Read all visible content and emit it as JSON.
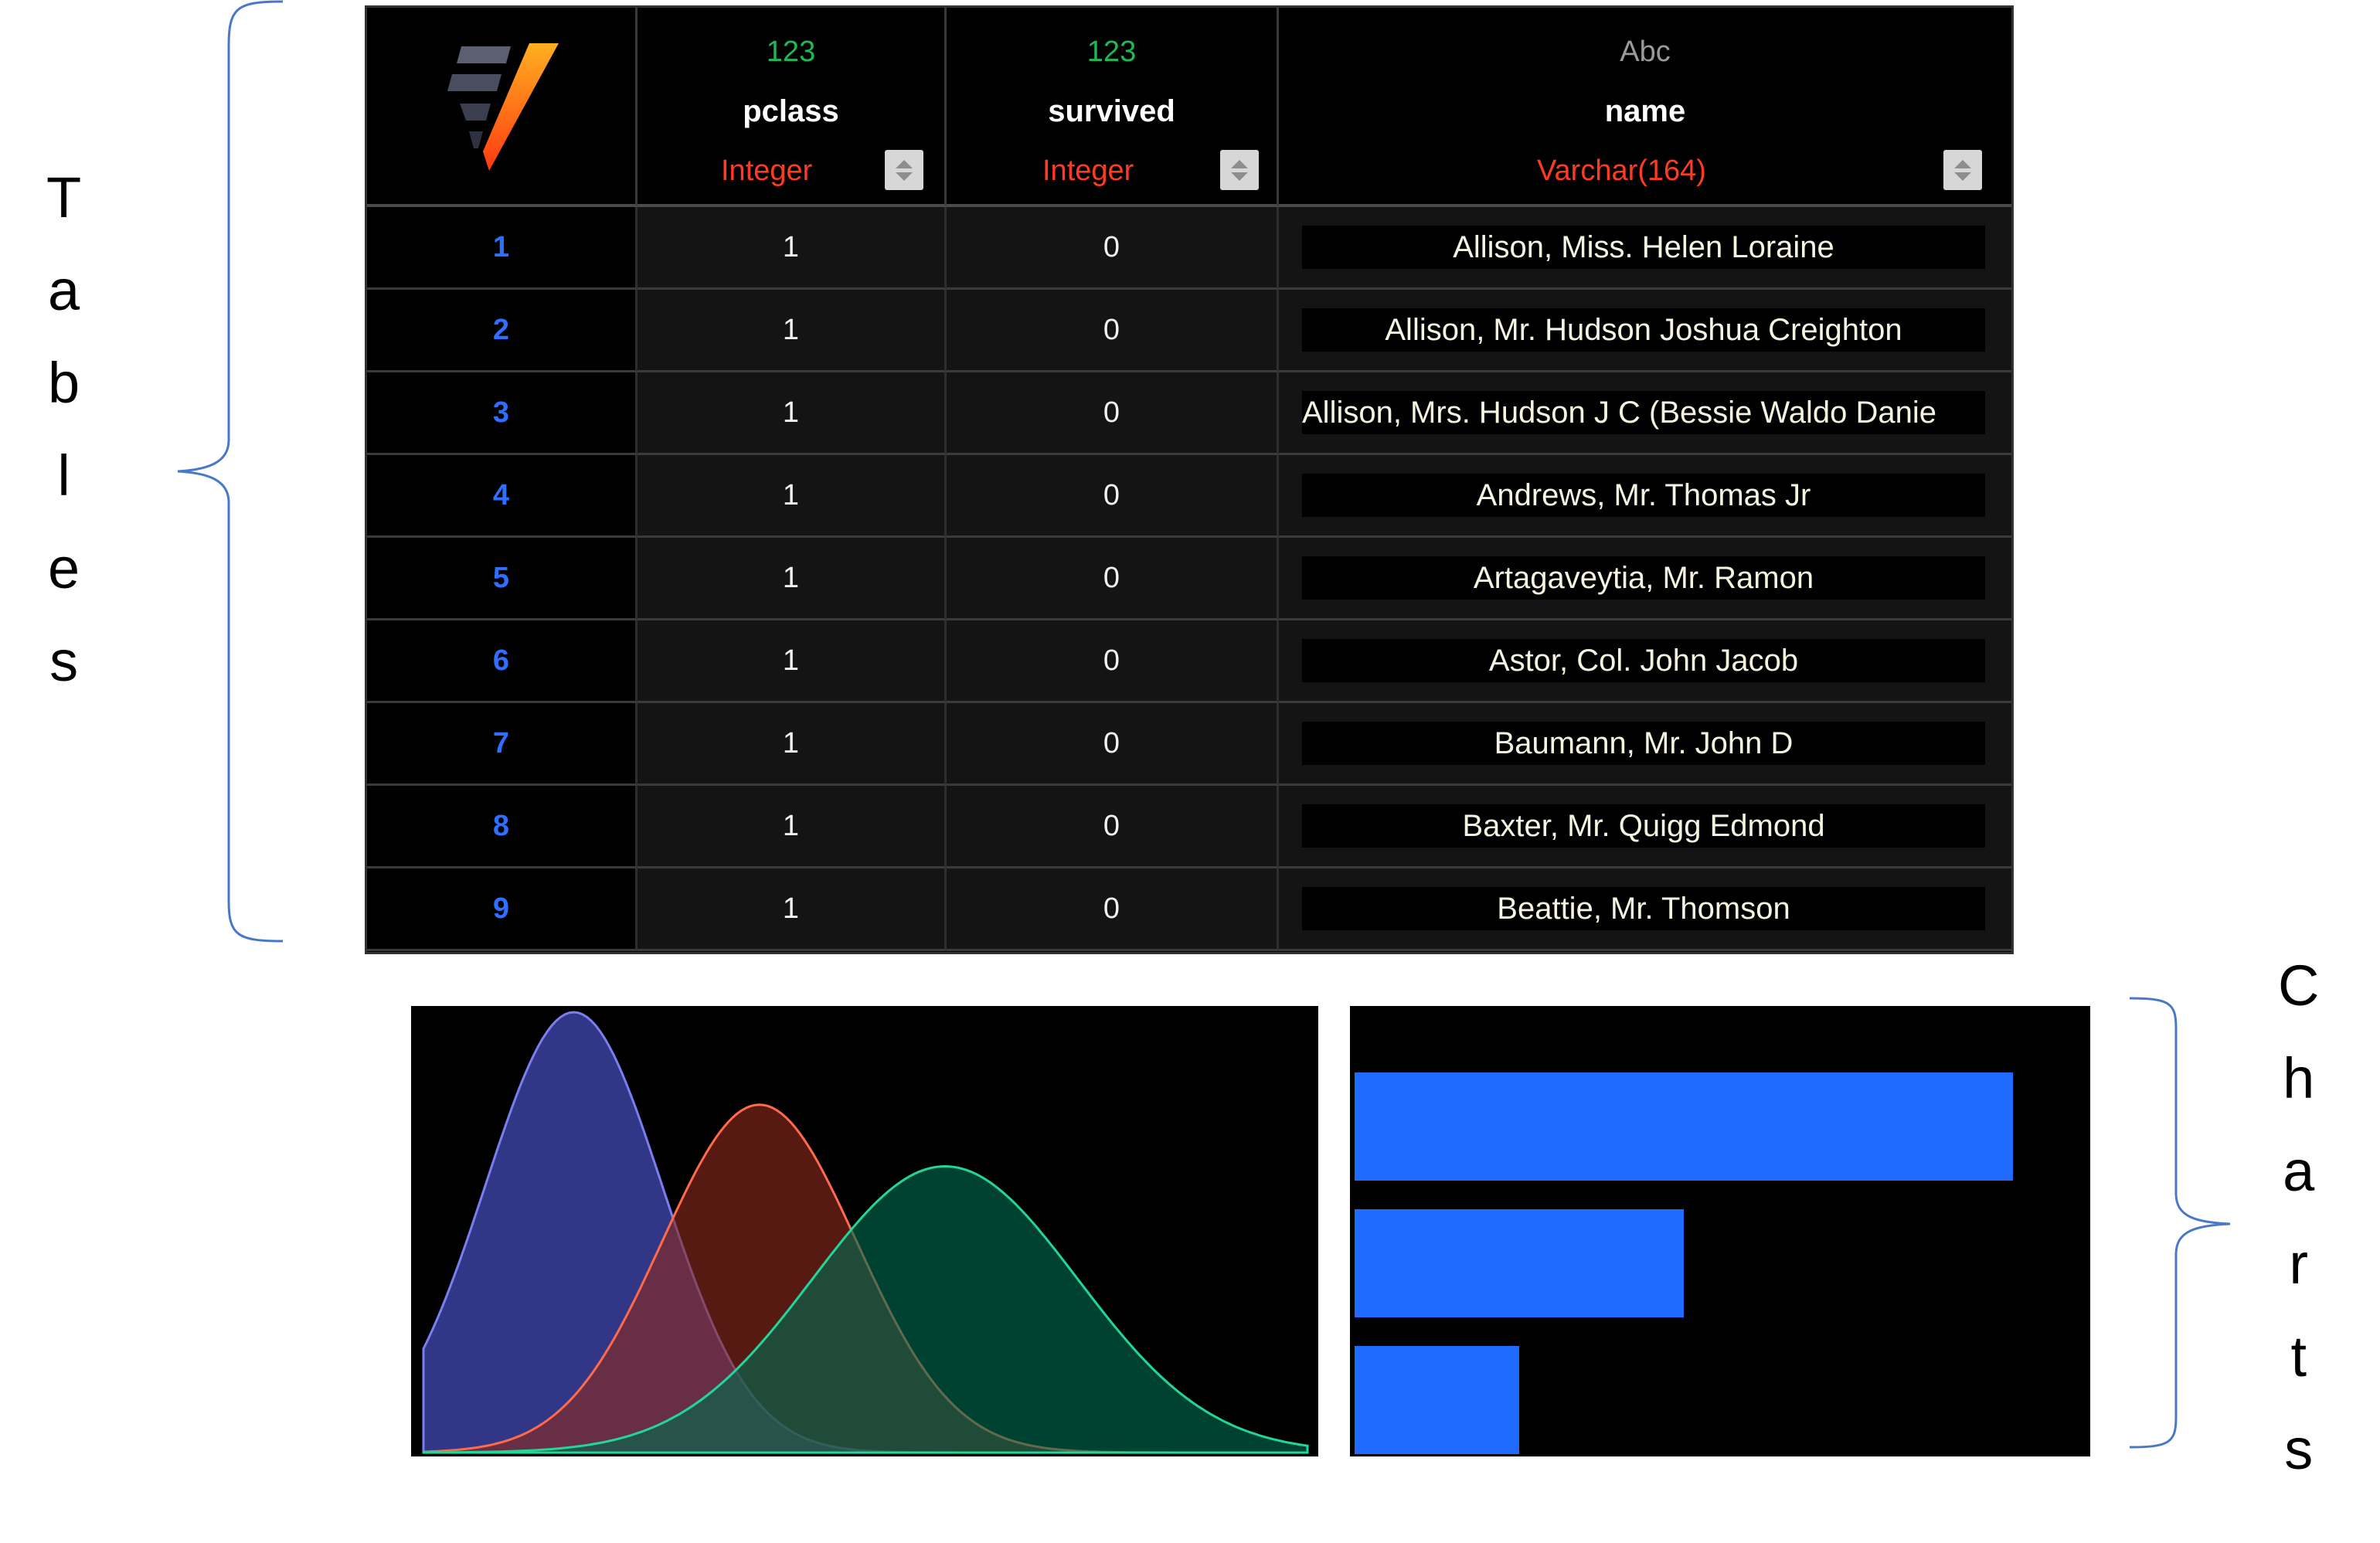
{
  "side_labels": {
    "tables": [
      "T",
      "a",
      "b",
      "l",
      "e",
      "s"
    ],
    "charts": [
      "C",
      "h",
      "a",
      "r",
      "t",
      "s"
    ]
  },
  "table": {
    "logo_icon": "v-logo-icon",
    "columns": [
      {
        "type_icon": "123",
        "type_icon_color": "#1db954",
        "name": "pclass",
        "type": "Integer"
      },
      {
        "type_icon": "123",
        "type_icon_color": "#1db954",
        "name": "survived",
        "type": "Integer"
      },
      {
        "type_icon": "Abc",
        "type_icon_color": "#9a9a9a",
        "name": "name",
        "type": "Varchar(164)"
      }
    ],
    "rows": [
      {
        "index": "1",
        "pclass": "1",
        "survived": "0",
        "name": "Allison, Miss. Helen Loraine"
      },
      {
        "index": "2",
        "pclass": "1",
        "survived": "0",
        "name": "Allison, Mr. Hudson Joshua Creighton"
      },
      {
        "index": "3",
        "pclass": "1",
        "survived": "0",
        "name": "Allison, Mrs. Hudson J C (Bessie Waldo Danie"
      },
      {
        "index": "4",
        "pclass": "1",
        "survived": "0",
        "name": "Andrews, Mr. Thomas Jr"
      },
      {
        "index": "5",
        "pclass": "1",
        "survived": "0",
        "name": "Artagaveytia, Mr. Ramon"
      },
      {
        "index": "6",
        "pclass": "1",
        "survived": "0",
        "name": "Astor, Col. John Jacob"
      },
      {
        "index": "7",
        "pclass": "1",
        "survived": "0",
        "name": "Baumann, Mr. John D"
      },
      {
        "index": "8",
        "pclass": "1",
        "survived": "0",
        "name": "Baxter, Mr. Quigg Edmond"
      },
      {
        "index": "9",
        "pclass": "1",
        "survived": "0",
        "name": "Beattie, Mr. Thomson"
      }
    ]
  },
  "colors": {
    "accent_blue": "#1f6bff",
    "type_red": "#ff3b1f",
    "series": [
      "#3a3f9e",
      "#8b2a1e",
      "#006b4f"
    ]
  },
  "chart_data": [
    {
      "type": "area",
      "title": "",
      "xlabel": "",
      "ylabel": "",
      "grid": false,
      "series": [
        {
          "color": "#3a3f9e",
          "stroke": "#7a7ff0",
          "mean": 0.17,
          "sd": 0.1,
          "peak": 1.0
        },
        {
          "color": "#8b2a1e",
          "stroke": "#ff6a4a",
          "mean": 0.38,
          "sd": 0.11,
          "peak": 0.79
        },
        {
          "color": "#006b4f",
          "stroke": "#22d69a",
          "mean": 0.59,
          "sd": 0.15,
          "peak": 0.65
        }
      ]
    },
    {
      "type": "bar",
      "orientation": "horizontal",
      "title": "",
      "xlabel": "",
      "ylabel": "",
      "grid": false,
      "values": [
        100,
        50,
        25
      ],
      "color": "#1f6bff"
    }
  ]
}
